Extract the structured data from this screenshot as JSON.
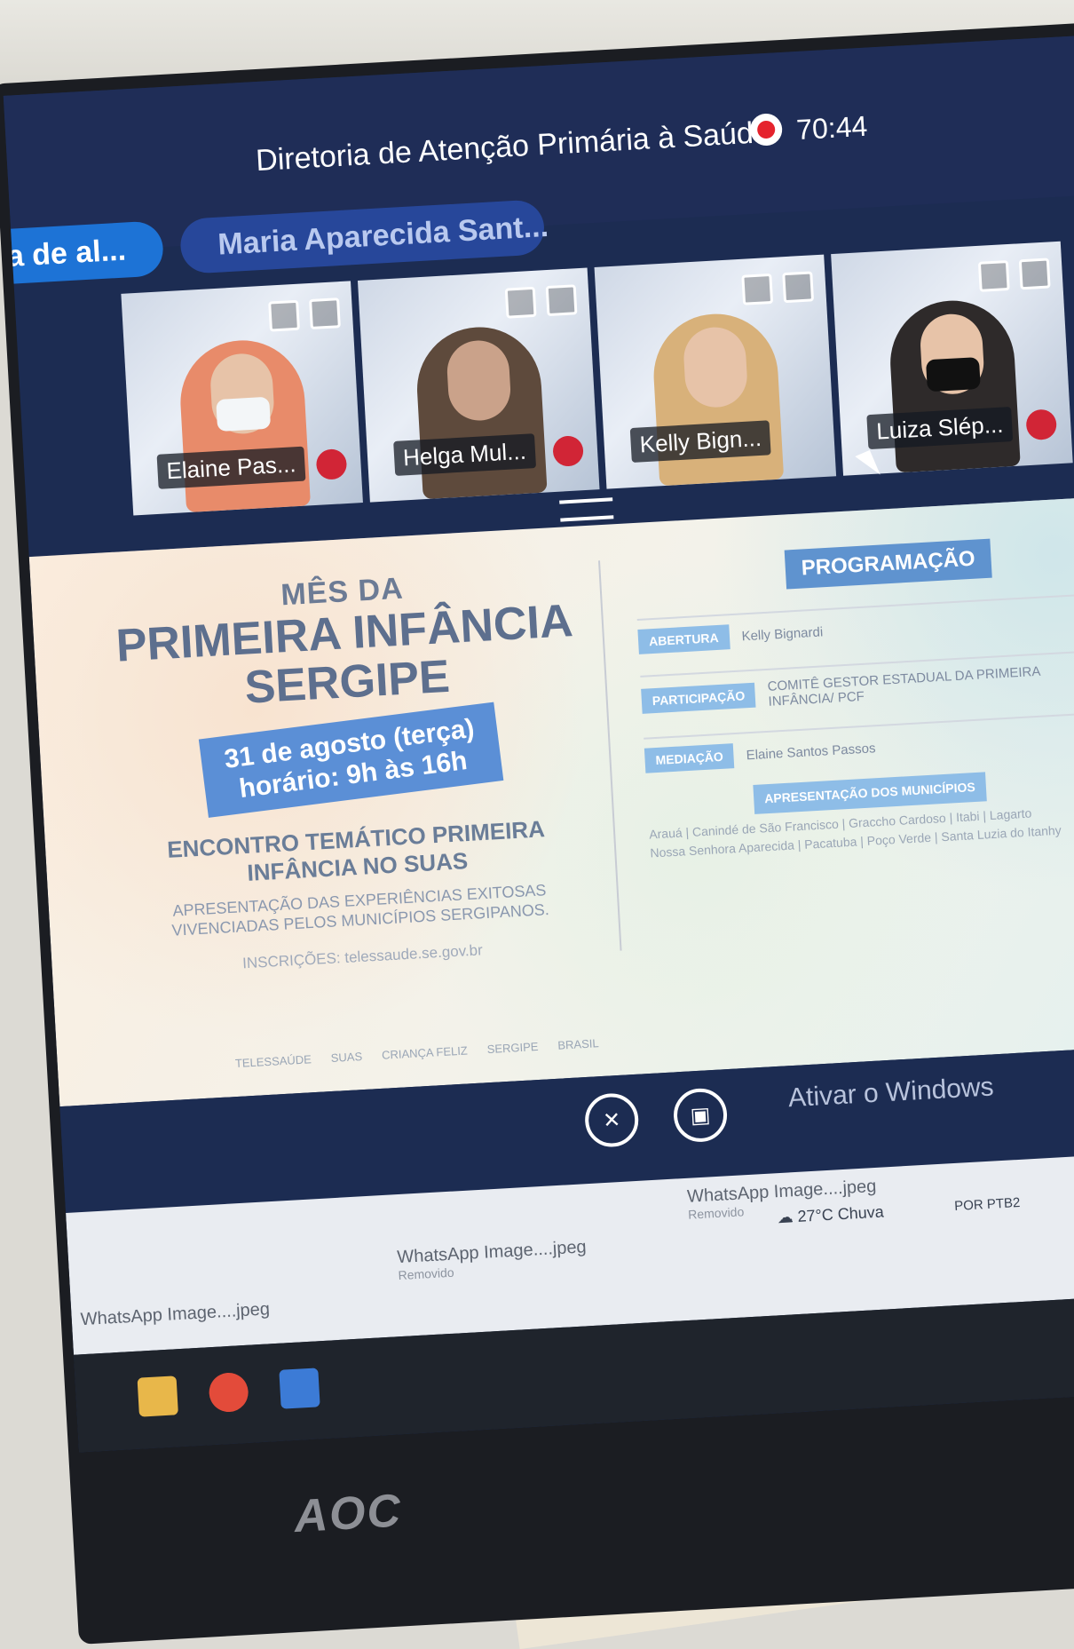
{
  "meeting": {
    "title": "Diretoria de Atenção Primária à Saúde",
    "recording_time": "70:44"
  },
  "speakers": [
    {
      "label": "a de al..."
    },
    {
      "label": "Maria Aparecida Sant..."
    }
  ],
  "participants": [
    {
      "name": "Elaine Pas..."
    },
    {
      "name": "Helga Mul..."
    },
    {
      "name": "Kelly Bign..."
    },
    {
      "name": "Luiza Slép..."
    }
  ],
  "slide": {
    "heading_small": "MÊS DA",
    "heading_big_1": "PRIMEIRA INFÂNCIA",
    "heading_big_2": "SERGIPE",
    "date_line_1": "31 de agosto (terça)",
    "date_line_2": "horário: 9h às 16h",
    "event_1": "ENCONTRO TEMÁTICO PRIMEIRA",
    "event_2": "INFÂNCIA NO SUAS",
    "desc_1": "APRESENTAÇÃO DAS EXPERIÊNCIAS EXITOSAS",
    "desc_2": "VIVENCIADAS PELOS MUNICÍPIOS SERGIPANOS.",
    "registration": "INSCRIÇÕES: telessaude.se.gov.br",
    "programacao": "PROGRAMAÇÃO",
    "rows": [
      {
        "tag": "ABERTURA",
        "text": "Kelly Bignardi"
      },
      {
        "tag": "PARTICIPAÇÃO",
        "text": "COMITÊ GESTOR ESTADUAL DA PRIMEIRA INFÂNCIA/ PCF"
      },
      {
        "tag": "MEDIAÇÃO",
        "text": "Elaine Santos Passos"
      }
    ],
    "municipios_tag": "APRESENTAÇÃO DOS MUNICÍPIOS",
    "municipios_1": "Arauá | Canindé de São Francisco | Graccho Cardoso | Itabi | Lagarto",
    "municipios_2": "Nossa Senhora Aparecida | Pacatuba | Poço Verde | Santa Luzia do Itanhy",
    "logos": [
      "SERGIPE",
      "BRASIL",
      "CRIANÇA FELIZ",
      "TELESSAÚDE",
      "SUAS"
    ]
  },
  "windows": {
    "activate": "Ativar o Windows",
    "download_1": "WhatsApp Image....jpeg",
    "download_2": "WhatsApp Image....jpeg",
    "download_3": "WhatsApp Image....jpeg",
    "download_sub": "Removido",
    "weather": "27°C Chuva",
    "lang": "POR",
    "lang2": "PTB2"
  },
  "monitor": {
    "brand": "AOC"
  },
  "colors": {
    "meet_bg": "#1f2d57",
    "record": "#e5232d",
    "pill_active": "#1d73d6",
    "pill": "#27479a",
    "slide_blue": "#5b8fd6"
  }
}
